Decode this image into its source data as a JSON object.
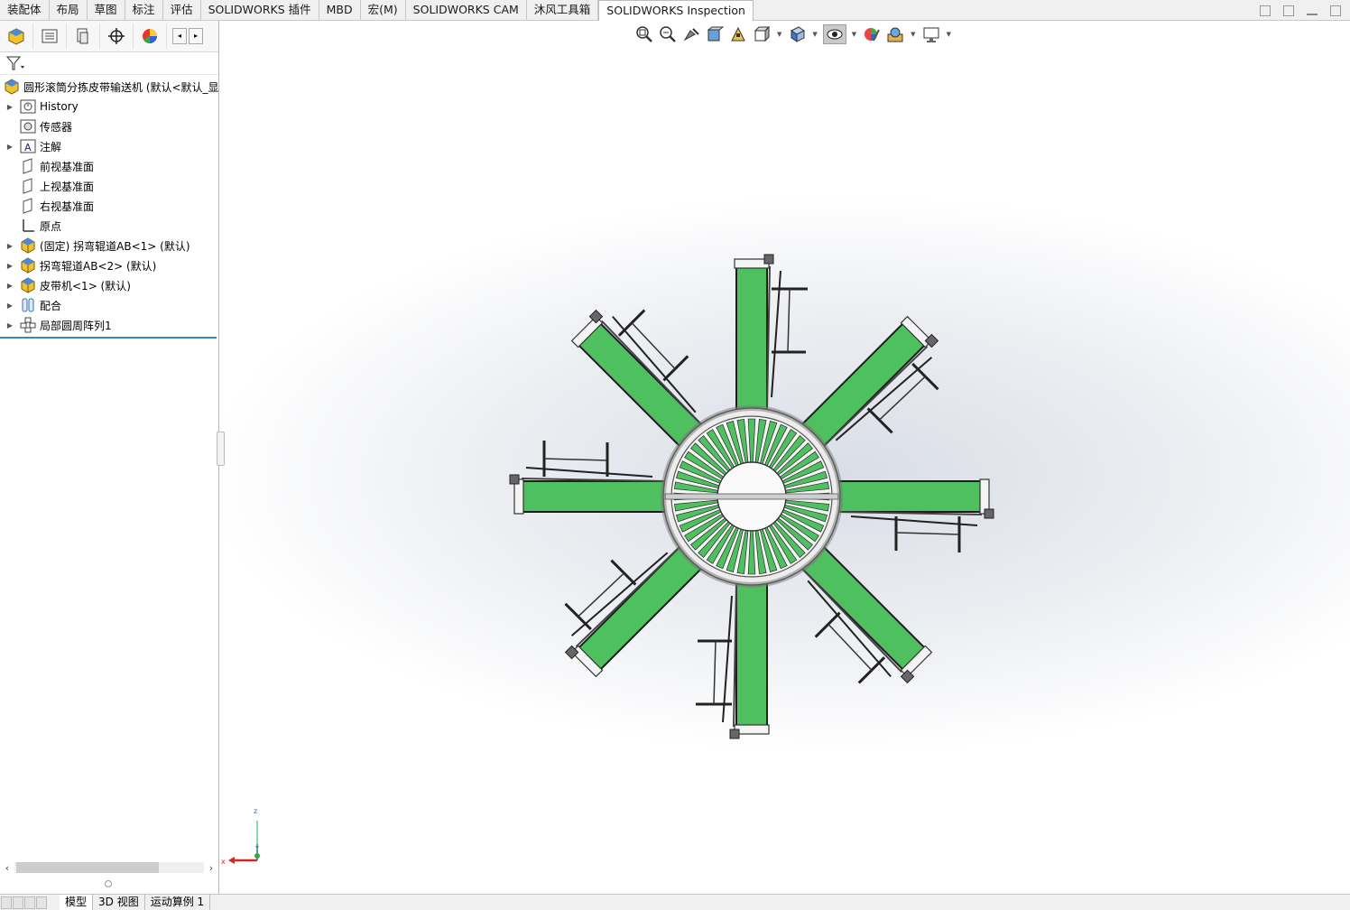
{
  "tabs": [
    {
      "label": "装配体",
      "active": false
    },
    {
      "label": "布局",
      "active": false
    },
    {
      "label": "草图",
      "active": false
    },
    {
      "label": "标注",
      "active": false
    },
    {
      "label": "评估",
      "active": false
    },
    {
      "label": "SOLIDWORKS 插件",
      "active": false
    },
    {
      "label": "MBD",
      "active": false
    },
    {
      "label": "宏(M)",
      "active": false
    },
    {
      "label": "SOLIDWORKS CAM",
      "active": false
    },
    {
      "label": "沐风工具箱",
      "active": false
    },
    {
      "label": "SOLIDWORKS Inspection",
      "active": true
    }
  ],
  "feature_tree": {
    "root": {
      "label": "圆形滚筒分拣皮带输送机 (默认<默认_显",
      "icon": "assembly-icon"
    },
    "items": [
      {
        "label": "History",
        "icon": "history-icon",
        "expandable": true
      },
      {
        "label": "传感器",
        "icon": "sensor-icon",
        "expandable": false
      },
      {
        "label": "注解",
        "icon": "annotation-icon",
        "expandable": true
      },
      {
        "label": "前视基准面",
        "icon": "plane-icon",
        "expandable": false
      },
      {
        "label": "上视基准面",
        "icon": "plane-icon",
        "expandable": false
      },
      {
        "label": "右视基准面",
        "icon": "plane-icon",
        "expandable": false
      },
      {
        "label": "原点",
        "icon": "origin-icon",
        "expandable": false
      },
      {
        "label": "(固定) 拐弯辊道AB<1> (默认)",
        "icon": "subassembly-icon",
        "expandable": true
      },
      {
        "label": "拐弯辊道AB<2> (默认)",
        "icon": "subassembly-icon",
        "expandable": true
      },
      {
        "label": "皮带机<1> (默认)",
        "icon": "subassembly-icon",
        "expandable": true
      },
      {
        "label": "配合",
        "icon": "mates-icon",
        "expandable": true
      },
      {
        "label": "局部圆周阵列1",
        "icon": "circular-pattern-icon",
        "expandable": true
      }
    ]
  },
  "bottom_tabs": [
    {
      "label": "模型",
      "active": true
    },
    {
      "label": "3D 视图",
      "active": false
    },
    {
      "label": "运动算例 1",
      "active": false
    }
  ],
  "triad": {
    "x": "x",
    "y": "y",
    "z": "z"
  },
  "colors": {
    "belt_green": "#4ec05f",
    "frame_gray": "#8c8c8c",
    "selection_blue": "#3c86c8"
  }
}
